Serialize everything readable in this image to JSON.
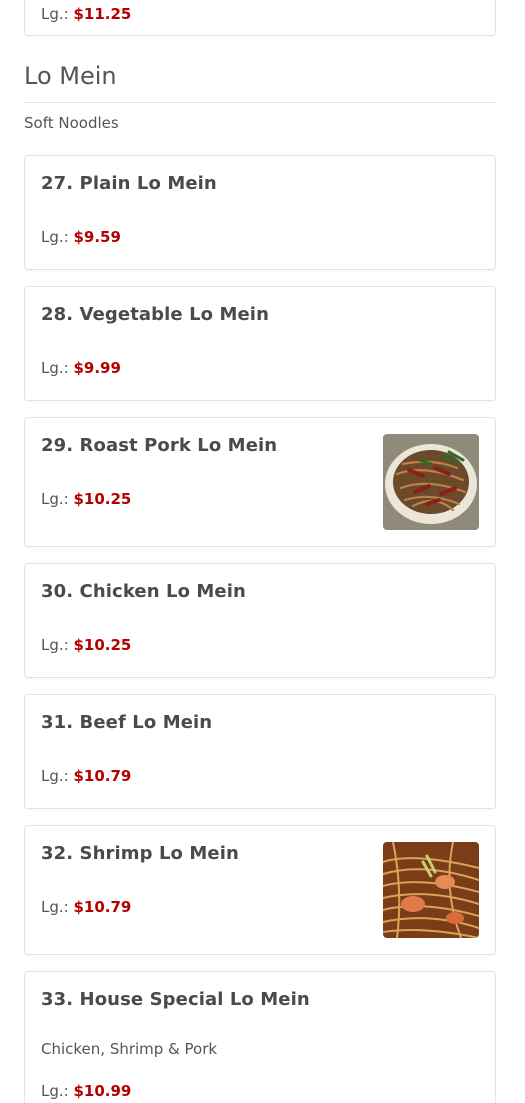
{
  "prev_item": {
    "price_label": "Lg.:",
    "price": "$11.25"
  },
  "section": {
    "title": "Lo Mein",
    "subtitle": "Soft Noodles"
  },
  "items": [
    {
      "title": "27. Plain Lo Mein",
      "price_label": "Lg.:",
      "price": "$9.59"
    },
    {
      "title": "28. Vegetable Lo Mein",
      "price_label": "Lg.:",
      "price": "$9.99"
    },
    {
      "title": "29. Roast Pork Lo Mein",
      "price_label": "Lg.:",
      "price": "$10.25"
    },
    {
      "title": "30. Chicken Lo Mein",
      "price_label": "Lg.:",
      "price": "$10.25"
    },
    {
      "title": "31. Beef Lo Mein",
      "price_label": "Lg.:",
      "price": "$10.79"
    },
    {
      "title": "32. Shrimp Lo Mein",
      "price_label": "Lg.:",
      "price": "$10.79"
    },
    {
      "title": "33. House Special Lo Mein",
      "description": "Chicken, Shrimp & Pork",
      "price_label": "Lg.:",
      "price": "$10.99"
    }
  ],
  "colors": {
    "price": "#b50000",
    "border": "#e3e3e3",
    "text": "#4a4a4a"
  }
}
